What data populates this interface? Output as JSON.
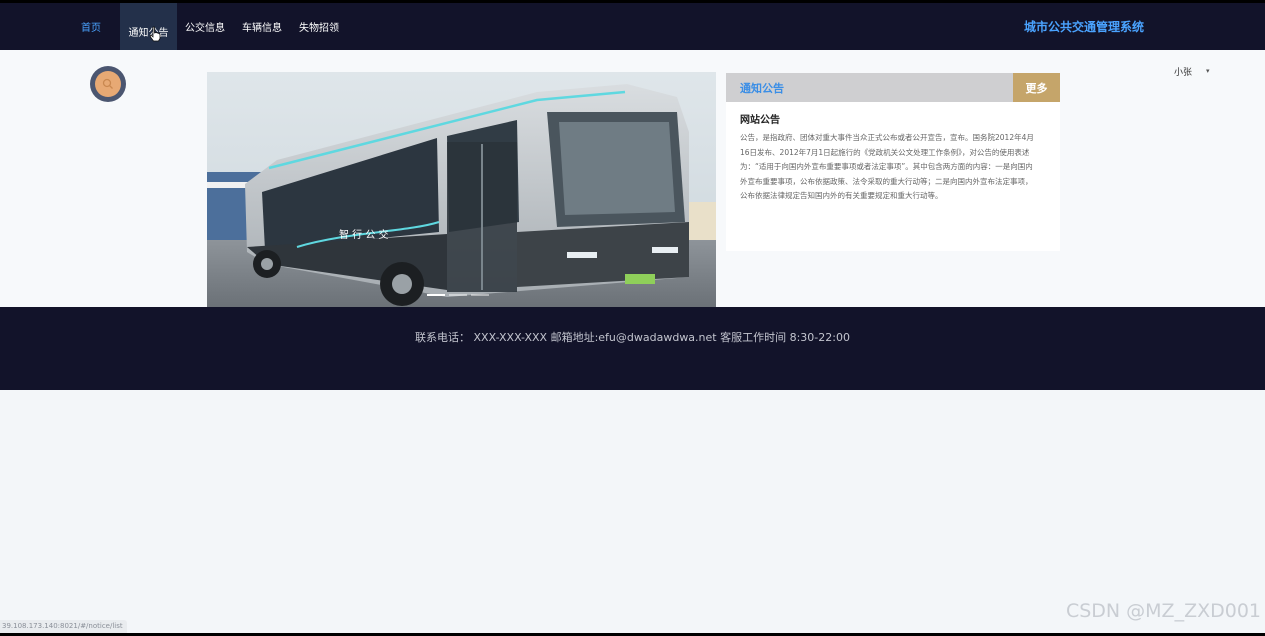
{
  "nav": {
    "items": [
      {
        "label": "首页"
      },
      {
        "label": "通知公告"
      },
      {
        "label": "公交信息"
      },
      {
        "label": "车辆信息"
      },
      {
        "label": "失物招领"
      }
    ],
    "active_index": 1,
    "brand": "城市公共交通管理系统"
  },
  "user": {
    "name": "小张",
    "caret": "▾"
  },
  "search": {
    "icon": "search-icon"
  },
  "carousel": {
    "bus_text": "智 行 公 交",
    "active_slide": 1,
    "slides": 3
  },
  "notice": {
    "header_title": "通知公告",
    "more_label": "更多",
    "item_title": "网站公告",
    "item_body": "公告，是指政府、团体对重大事件当众正式公布或者公开宣告，宣布。国务院2012年4月16日发布、2012年7月1日起施行的《党政机关公文处理工作条例》，对公告的使用表述为：“适用于向国内外宣布重要事项或者法定事项”。其中包含两方面的内容：一是向国内外宣布重要事项，公布依据政策、法令采取的重大行动等；二是向国内外宣布法定事项，公布依据法律规定告知国内外的有关重要规定和重大行动等。"
  },
  "footer": {
    "text": "联系电话：  XXX-XXX-XXX 邮箱地址:efu@dwadawdwa.net 客服工作时间 8:30-22:00"
  },
  "status_url": "39.108.173.140:8021/#/notice/list",
  "watermark": "CSDN @MZ_ZXD001",
  "colors": {
    "nav_bg": "#12132a",
    "accent": "#4aa3ff",
    "more_button": "#c5a56a",
    "active_nav": "#23304a"
  }
}
